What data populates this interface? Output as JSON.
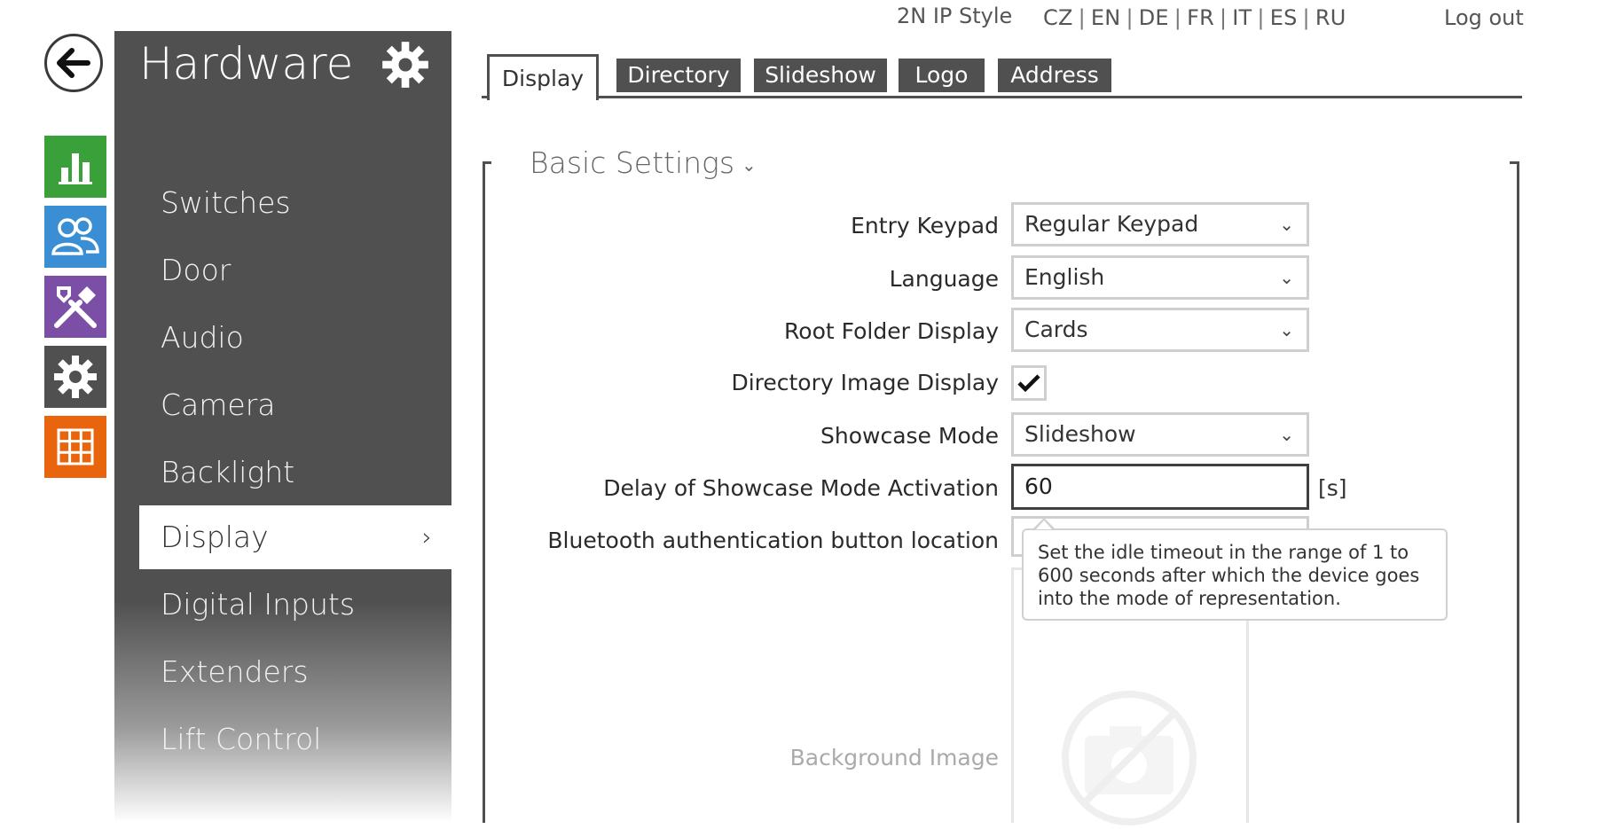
{
  "topbar": {
    "style_link": "2N IP Style",
    "languages": [
      "CZ",
      "EN",
      "DE",
      "FR",
      "IT",
      "ES",
      "RU"
    ],
    "logout": "Log out"
  },
  "rail": {
    "icons": [
      "back-arrow-icon",
      "status-chart-icon",
      "directory-users-icon",
      "services-tools-icon",
      "hardware-gear-icon",
      "system-grid-icon"
    ],
    "colors": [
      "#3aa13a",
      "#3a8fd4",
      "#7b4fa6",
      "#505050",
      "#e8650d"
    ]
  },
  "sidebar": {
    "title": "Hardware",
    "items": [
      {
        "label": "Switches"
      },
      {
        "label": "Door"
      },
      {
        "label": "Audio"
      },
      {
        "label": "Camera"
      },
      {
        "label": "Backlight"
      },
      {
        "label": "Display",
        "active": true
      },
      {
        "label": "Digital Inputs"
      },
      {
        "label": "Extenders"
      },
      {
        "label": "Lift Control"
      }
    ],
    "active_chevron": "›"
  },
  "tabs": [
    {
      "label": "Display",
      "active": true
    },
    {
      "label": "Directory"
    },
    {
      "label": "Slideshow"
    },
    {
      "label": "Logo"
    },
    {
      "label": "Address"
    }
  ],
  "section": {
    "title": "Basic Settings",
    "caret": "⌄"
  },
  "form": {
    "entry_keypad": {
      "label": "Entry Keypad",
      "value": "Regular Keypad"
    },
    "language": {
      "label": "Language",
      "value": "English"
    },
    "root_folder_display": {
      "label": "Root Folder Display",
      "value": "Cards"
    },
    "directory_image_display": {
      "label": "Directory Image Display",
      "checked": true
    },
    "showcase_mode": {
      "label": "Showcase Mode",
      "value": "Slideshow"
    },
    "delay_showcase": {
      "label": "Delay of Showcase Mode Activation",
      "value": "60",
      "unit": "[s]"
    },
    "bluetooth_location": {
      "label": "Bluetooth authentication button location"
    },
    "background_image": {
      "label": "Background Image"
    }
  },
  "tooltip": {
    "text": "Set the idle timeout in the range of 1 to 600 seconds after which the device goes into the mode of representation."
  },
  "dropdown_glyph": "⌄"
}
